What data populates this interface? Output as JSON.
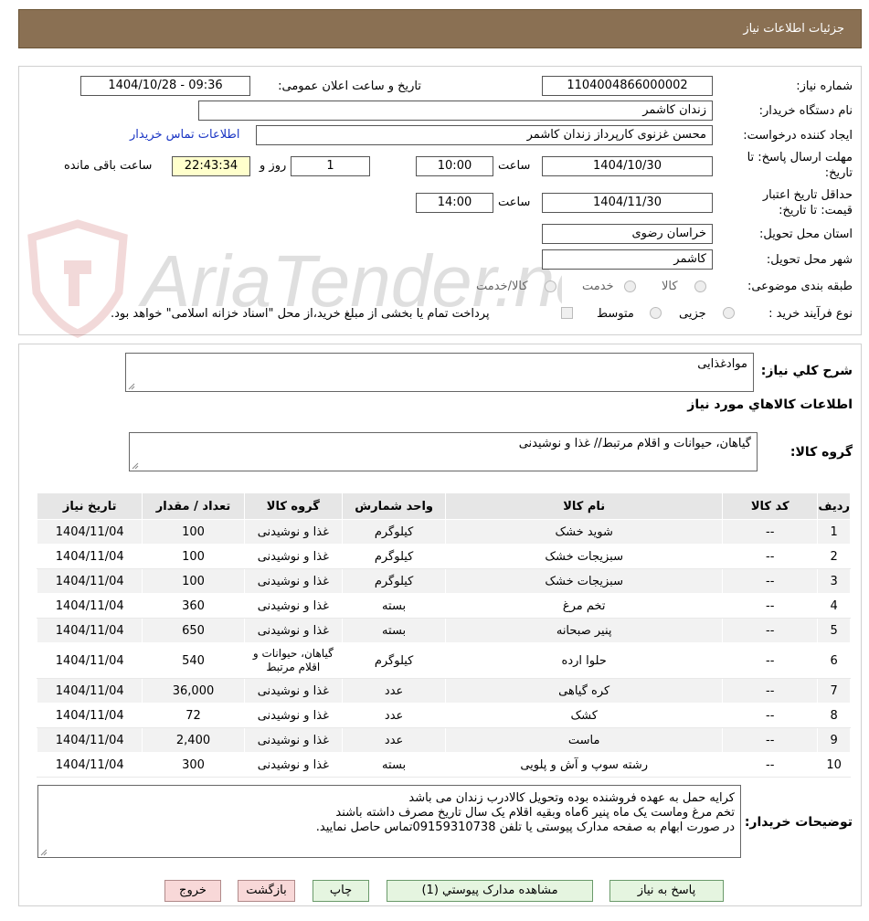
{
  "header": {
    "title": "جزئیات اطلاعات نیاز"
  },
  "form": {
    "need_number_label": "شماره نیاز:",
    "need_number": "1104004866000002",
    "announce_label": "تاریخ و ساعت اعلان عمومی:",
    "announce_value": "1404/10/28 - 09:36",
    "buyer_label": "نام دستگاه خریدار:",
    "buyer_value": "زندان کاشمر",
    "creator_label": "ایجاد کننده درخواست:",
    "creator_value": "محسن غزنوی کارپرداز زندان کاشمر",
    "contact_link": "اطلاعات تماس خریدار",
    "deadline_label_1": "مهلت ارسال پاسخ: تا",
    "deadline_label_2": "تاریخ:",
    "deadline_date": "1404/10/30",
    "time_label": "ساعت",
    "deadline_time": "10:00",
    "days_value": "1",
    "days_label": "روز و",
    "remaining_time": "22:43:34",
    "remaining_label": "ساعت باقی مانده",
    "validity_label_1": "حداقل تاریخ اعتبار",
    "validity_label_2": "قیمت: تا تاریخ:",
    "validity_date": "1404/11/30",
    "validity_time": "14:00",
    "province_label": "استان محل تحویل:",
    "province_value": "خراسان رضوی",
    "city_label": "شهر محل تحویل:",
    "city_value": "کاشمر",
    "category_label": "طبقه بندی موضوعی:",
    "category_options": [
      "کالا",
      "خدمت",
      "کالا/خدمت"
    ],
    "process_label": "نوع فرآیند خرید :",
    "process_options": [
      "جزیی",
      "متوسط"
    ],
    "payment_note": "پرداخت تمام یا بخشی از مبلغ خرید،از محل \"اسناد خزانه اسلامی\" خواهد بود."
  },
  "summary": {
    "general_label": "شرح کلي نياز:",
    "general_value": "موادغذایی",
    "items_heading": "اطلاعات کالاهاي مورد نياز",
    "group_label": "گروه کالا:",
    "group_value": "گیاهان، حیوانات و اقلام مرتبط// غذا و نوشیدنی"
  },
  "table": {
    "headers": [
      "رديف",
      "کد کالا",
      "نام کالا",
      "واحد شمارش",
      "گروه کالا",
      "تعداد / مقدار",
      "تاریخ نیاز"
    ],
    "rows": [
      [
        "1",
        "--",
        "شوید خشک",
        "کیلوگرم",
        "غذا و نوشیدنی",
        "100",
        "1404/11/04"
      ],
      [
        "2",
        "--",
        "سبزیجات خشک",
        "کیلوگرم",
        "غذا و نوشیدنی",
        "100",
        "1404/11/04"
      ],
      [
        "3",
        "--",
        "سبزیجات خشک",
        "کیلوگرم",
        "غذا و نوشیدنی",
        "100",
        "1404/11/04"
      ],
      [
        "4",
        "--",
        "تخم مرغ",
        "بسته",
        "غذا و نوشیدنی",
        "360",
        "1404/11/04"
      ],
      [
        "5",
        "--",
        "پنیر صبحانه",
        "بسته",
        "غذا و نوشیدنی",
        "650",
        "1404/11/04"
      ],
      [
        "6",
        "--",
        "حلوا ارده",
        "کیلوگرم",
        "گیاهان، حیوانات و اقلام مرتبط",
        "540",
        "1404/11/04"
      ],
      [
        "7",
        "--",
        "کره گیاهی",
        "عدد",
        "غذا و نوشیدنی",
        "36,000",
        "1404/11/04"
      ],
      [
        "8",
        "--",
        "کشک",
        "عدد",
        "غذا و نوشیدنی",
        "72",
        "1404/11/04"
      ],
      [
        "9",
        "--",
        "ماست",
        "عدد",
        "غذا و نوشیدنی",
        "2,400",
        "1404/11/04"
      ],
      [
        "10",
        "--",
        "رشته سوپ و آش و پلویی",
        "بسته",
        "غذا و نوشیدنی",
        "300",
        "1404/11/04"
      ]
    ]
  },
  "notes": {
    "label": "توضیحات خریدار:",
    "lines": [
      "کرایه حمل به عهده فروشنده بوده وتحویل کالادرب زندان می باشد",
      "تخم مرغ وماست یک ماه پنیر 6ماه وبقیه اقلام یک سال تاریخ مصرف داشته باشند",
      "در صورت ابهام به صفحه مدارک پیوستی یا تلفن 09159310738تماس حاصل نمایید."
    ]
  },
  "buttons": {
    "reply": "پاسخ به نياز",
    "attachments": "مشاهده مدارک پيوستي (1)",
    "print": "چاپ",
    "back": "بازگشت",
    "exit": "خروج"
  },
  "watermark": {
    "text": "AriaTender.neT"
  },
  "colors": {
    "header": "#8a7053",
    "button": "#e5f5e0",
    "button_red": "#f8d8d8",
    "remaining": "#ffffcc",
    "link": "#1a35c4"
  }
}
